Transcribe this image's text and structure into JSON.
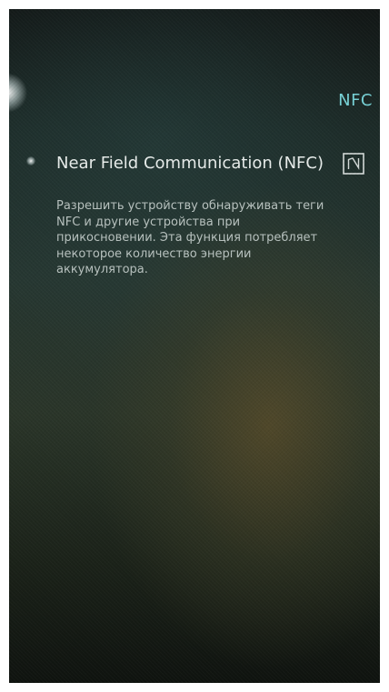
{
  "header": {
    "title": "NFC"
  },
  "nfc_setting": {
    "title": "Near Field Communication (NFC)",
    "description": "Разрешить устройству обнаруживать теги NFC и другие устройства при прикосновении. Эта функция потребляет некоторое количество энергии аккумулятора.",
    "toggle_icon": "nfc-n-icon",
    "enabled": false
  },
  "colors": {
    "accent": "#78d4d8",
    "title_text": "#e9eeec",
    "body_text": "#b9c3c0"
  }
}
